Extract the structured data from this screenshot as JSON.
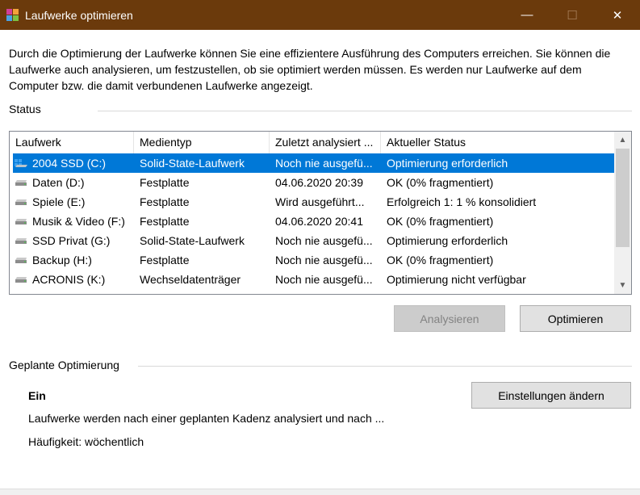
{
  "window": {
    "title": "Laufwerke optimieren",
    "minimize": "—",
    "maximize": "☐",
    "close": "✕"
  },
  "intro": "Durch die Optimierung der Laufwerke können Sie eine effizientere Ausführung des Computers erreichen. Sie können die Laufwerke auch analysieren, um festzustellen, ob sie optimiert werden müssen. Es werden nur Laufwerke auf dem Computer bzw. die damit verbundenen Laufwerke angezeigt.",
  "status_section": {
    "label": "Status"
  },
  "table": {
    "columns": [
      "Laufwerk",
      "Medientyp",
      "Zuletzt analysiert ...",
      "Aktueller Status"
    ],
    "rows": [
      {
        "drive": "2004 SSD (C:)",
        "media": "Solid-State-Laufwerk",
        "last": "Noch nie ausgefü...",
        "status": "Optimierung erforderlich",
        "icon": "windows-drive-icon"
      },
      {
        "drive": "Daten (D:)",
        "media": "Festplatte",
        "last": "04.06.2020 20:39",
        "status": "OK (0% fragmentiert)",
        "icon": "drive-icon"
      },
      {
        "drive": "Spiele (E:)",
        "media": "Festplatte",
        "last": "Wird ausgeführt...",
        "status": "Erfolgreich 1: 1 % konsolidiert",
        "icon": "drive-icon"
      },
      {
        "drive": "Musik & Video (F:)",
        "media": "Festplatte",
        "last": "04.06.2020 20:41",
        "status": "OK (0% fragmentiert)",
        "icon": "drive-icon"
      },
      {
        "drive": "SSD Privat (G:)",
        "media": "Solid-State-Laufwerk",
        "last": "Noch nie ausgefü...",
        "status": "Optimierung erforderlich",
        "icon": "drive-icon"
      },
      {
        "drive": "Backup (H:)",
        "media": "Festplatte",
        "last": "Noch nie ausgefü...",
        "status": "OK (0% fragmentiert)",
        "icon": "drive-icon"
      },
      {
        "drive": "ACRONIS (K:)",
        "media": "Wechseldatenträger",
        "last": "Noch nie ausgefü...",
        "status": "Optimierung nicht verfügbar",
        "icon": "drive-icon"
      }
    ],
    "selected_index": 0
  },
  "buttons": {
    "analyze": "Analysieren",
    "optimize": "Optimieren",
    "change_settings": "Einstellungen ändern"
  },
  "scheduled": {
    "label": "Geplante Optimierung",
    "status": "Ein",
    "description": "Laufwerke werden nach einer geplanten Kadenz analysiert und nach ...",
    "frequency": "Häufigkeit: wöchentlich"
  },
  "colors": {
    "titlebar": "#6b3a0c",
    "selection": "#0078d7"
  }
}
